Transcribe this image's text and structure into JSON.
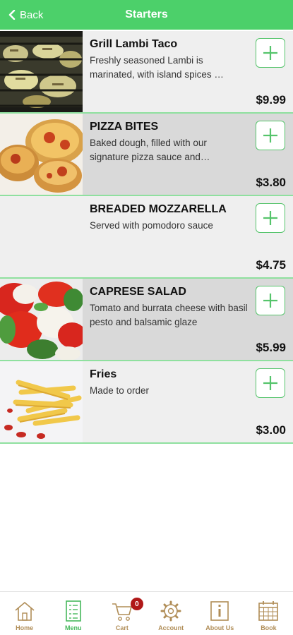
{
  "header": {
    "back_label": "Back",
    "title": "Starters"
  },
  "items": [
    {
      "name": "Grill Lambi Taco",
      "description": "Freshly seasoned Lambi is marinated, with island spices …",
      "price": "$9.99"
    },
    {
      "name": "PIZZA BITES",
      "description": "Baked dough, filled with our signature pizza sauce and…",
      "price": "$3.80"
    },
    {
      "name": "BREADED MOZZARELLA",
      "description": "Served with pomodoro sauce",
      "price": "$4.75"
    },
    {
      "name": "CAPRESE SALAD",
      "description": "Tomato and burrata cheese with basil pesto and balsamic glaze",
      "price": "$5.99"
    },
    {
      "name": "Fries",
      "description": "Made to order",
      "price": "$3.00"
    }
  ],
  "tabbar": {
    "tabs": [
      {
        "label": "Home",
        "icon": "home-icon"
      },
      {
        "label": "Menu",
        "icon": "menu-icon"
      },
      {
        "label": "Cart",
        "icon": "cart-icon"
      },
      {
        "label": "Account",
        "icon": "gear-icon"
      },
      {
        "label": "About Us",
        "icon": "info-icon"
      },
      {
        "label": "Book",
        "icon": "calendar-icon"
      }
    ],
    "active": "Menu",
    "cart_count": "0"
  },
  "colors": {
    "header": "#4cd06a",
    "accent": "#55c46b",
    "tab_inactive": "#b08d57",
    "tab_active": "#46b85c",
    "badge": "#b01818"
  }
}
